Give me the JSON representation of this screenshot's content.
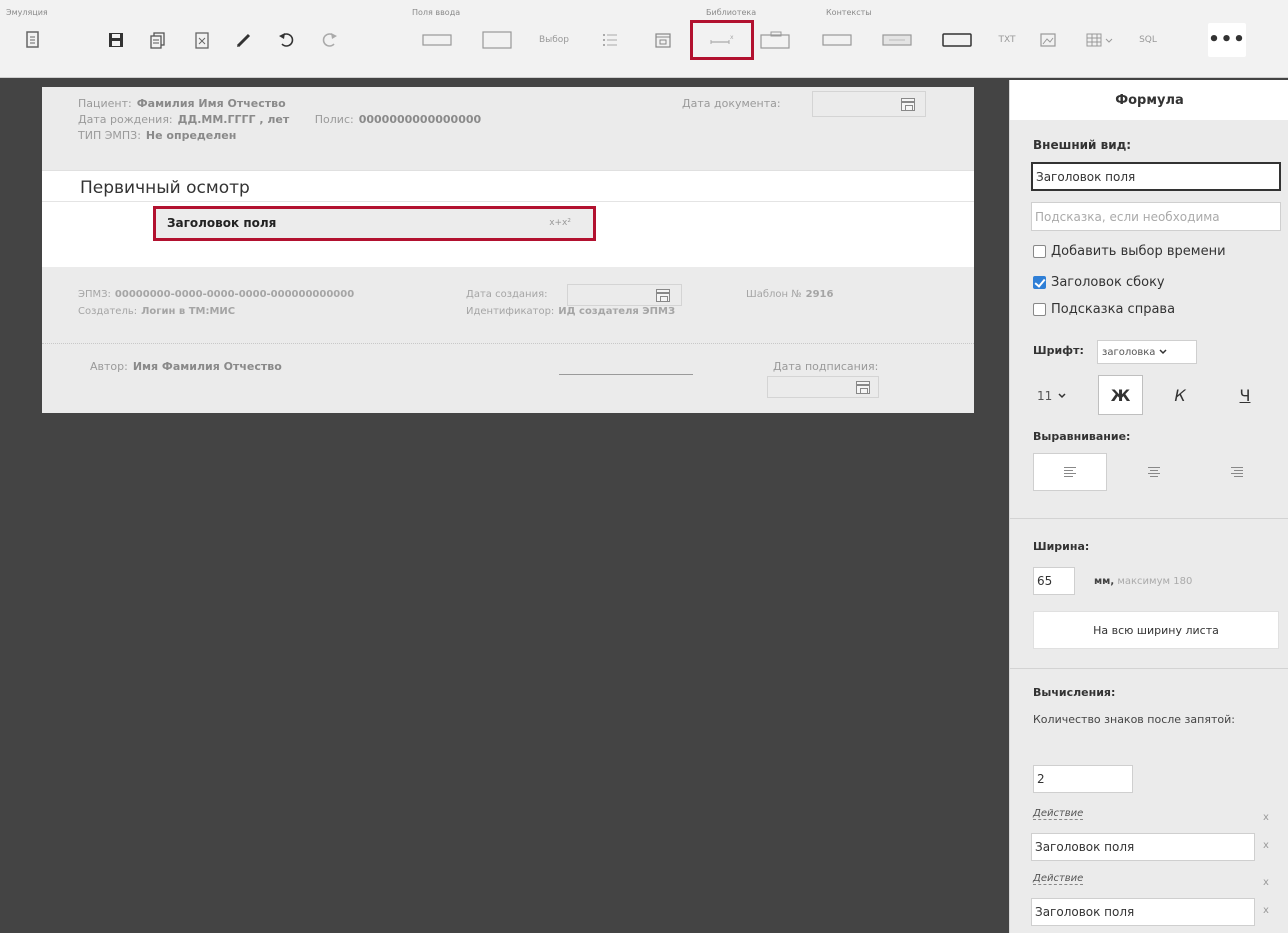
{
  "toolbar": {
    "groups": {
      "emulation": "Эмуляция",
      "input_fields": "Поля ввода",
      "library": "Библиотека",
      "contexts": "Контексты"
    },
    "buttons": {
      "vybor": "Выбор",
      "txt": "TXT",
      "sql": "SQL"
    }
  },
  "document": {
    "patient_label": "Пациент:",
    "patient_value": "Фамилия Имя Отчество",
    "birth_label": "Дата рождения:",
    "birth_value": "ДД.ММ.ГГГГ , лет",
    "policy_label": "Полис:",
    "policy_value": "0000000000000000",
    "emz_type_label": "ТИП ЭМПЗ:",
    "emz_type_value": "Не определен",
    "doc_date_label": "Дата документа:",
    "section_title": "Первичный осмотр",
    "field_label": "Заголовок поля",
    "footer": {
      "emz_label": "ЭПМЗ:",
      "emz_value": "00000000-0000-0000-0000-000000000000",
      "creator_label": "Создатель:",
      "creator_value": "Логин в ТМ:МИС",
      "created_label": "Дата создания:",
      "template_label": "Шаблон №",
      "template_value": "2916",
      "identifier_label": "Идентификатор:",
      "identifier_value": "ИД создателя ЭПМЗ",
      "author_label": "Автор:",
      "author_value": "Имя Фамилия Отчество",
      "signing_label": "Дата подписания:"
    }
  },
  "panel": {
    "title": "Формула",
    "appearance_label": "Внешний вид:",
    "title_input_value": "Заголовок поля",
    "hint_placeholder": "Подсказка, если необходима",
    "checkboxes": [
      {
        "label": "Добавить выбор времени",
        "checked": false
      },
      {
        "label": "Заголовок сбоку",
        "checked": true
      },
      {
        "label": "Подсказка справа",
        "checked": false
      }
    ],
    "font_label": "Шрифт:",
    "font_value": "заголовка",
    "font_size": "11",
    "bold": "Ж",
    "italic": "К",
    "underline": "Ч",
    "align_label": "Выравнивание:",
    "width_label": "Ширина:",
    "width_value": "65",
    "width_unit": "мм,",
    "width_max": "максимум 180",
    "full_width_button": "На всю ширину листа",
    "calc_label": "Вычисления:",
    "decimals_label": "Количество знаков после запятой:",
    "decimals_value": "2",
    "actions": [
      {
        "label": "Действие",
        "value": "Заголовок поля"
      },
      {
        "label": "Действие",
        "value": "Заголовок поля"
      }
    ],
    "remove": "x"
  }
}
